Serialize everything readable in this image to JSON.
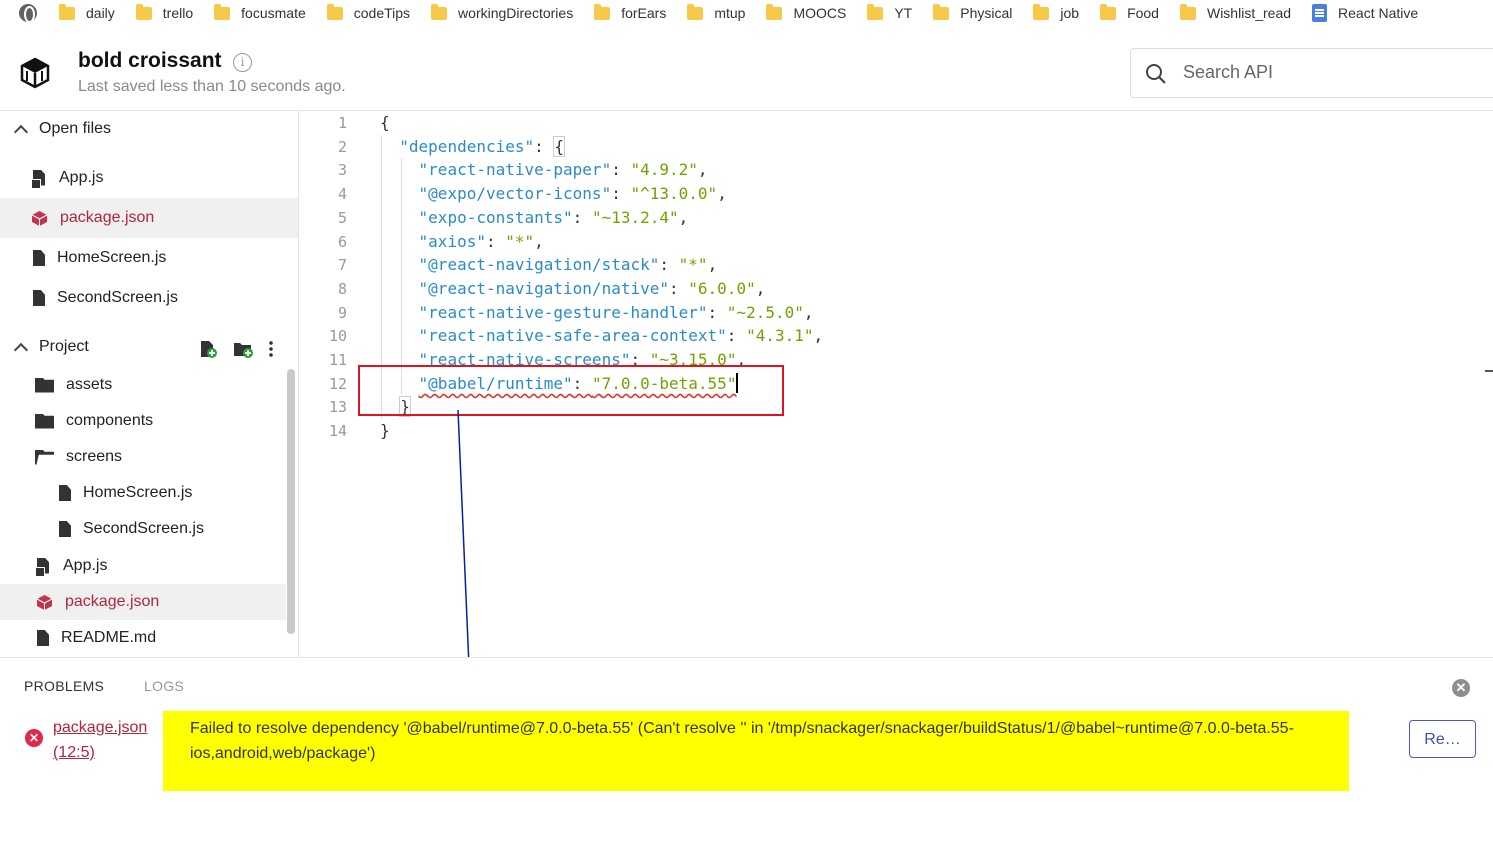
{
  "bookmarks": [
    {
      "label": "daily",
      "icon": "folder-icon"
    },
    {
      "label": "trello",
      "icon": "folder-icon"
    },
    {
      "label": "focusmate",
      "icon": "folder-icon"
    },
    {
      "label": "codeTips",
      "icon": "folder-icon"
    },
    {
      "label": "workingDirectories",
      "icon": "folder-icon"
    },
    {
      "label": "forEars",
      "icon": "folder-icon"
    },
    {
      "label": "mtup",
      "icon": "folder-icon"
    },
    {
      "label": "MOOCS",
      "icon": "folder-icon"
    },
    {
      "label": "YT",
      "icon": "folder-icon"
    },
    {
      "label": "Physical",
      "icon": "folder-icon"
    },
    {
      "label": "job",
      "icon": "folder-icon"
    },
    {
      "label": "Food",
      "icon": "folder-icon"
    },
    {
      "label": "Wishlist_read",
      "icon": "folder-icon"
    },
    {
      "label": "React Native",
      "icon": "doc-icon"
    }
  ],
  "header": {
    "title": "bold croissant",
    "saved": "Last saved less than 10 seconds ago.",
    "info_glyph": "i",
    "search_placeholder": "Search API"
  },
  "sidebar": {
    "open_files_label": "Open files",
    "open_files": [
      "App.js",
      "package.json",
      "HomeScreen.js",
      "SecondScreen.js"
    ],
    "project_label": "Project",
    "project_items": [
      "assets",
      "components",
      "screens",
      "HomeScreen.js",
      "SecondScreen.js",
      "App.js",
      "package.json",
      "README.md"
    ]
  },
  "editor": {
    "line_numbers": [
      "1",
      "2",
      "3",
      "4",
      "5",
      "6",
      "7",
      "8",
      "9",
      "10",
      "11",
      "12",
      "13",
      "14"
    ],
    "deps": [
      {
        "name": "react-native-paper",
        "version": "4.9.2"
      },
      {
        "name": "@expo/vector-icons",
        "version": "^13.0.0"
      },
      {
        "name": "expo-constants",
        "version": "~13.2.4"
      },
      {
        "name": "axios",
        "version": "*"
      },
      {
        "name": "@react-navigation/stack",
        "version": "*"
      },
      {
        "name": "@react-navigation/native",
        "version": "6.0.0"
      },
      {
        "name": "react-native-gesture-handler",
        "version": "~2.5.0"
      },
      {
        "name": "react-native-safe-area-context",
        "version": "4.3.1"
      },
      {
        "name": "react-native-screens",
        "version": "~3.15.0"
      },
      {
        "name": "@babel/runtime",
        "version": "7.0.0-beta.55"
      }
    ],
    "root_key": "dependencies",
    "brace_open": "{",
    "brace_close": "}"
  },
  "panel": {
    "tab_problems": "PROBLEMS",
    "tab_logs": "LOGS",
    "close_glyph": "✕",
    "error_glyph": "✕",
    "error_file": "package.json",
    "error_pos": "(12:5)",
    "error_message": "Failed to resolve dependency '@babel/runtime@7.0.0-beta.55' (Can't resolve '' in '/tmp/snackager/snackager/buildStatus/1/@babel~runtime@7.0.0-beta.55-ios,android,web/package')",
    "retry_label": "Re…"
  },
  "colors": {
    "key": "#2a8bc7",
    "value": "#6da400",
    "error": "#b0263a",
    "highlight": "#ffff00",
    "annotation": "#e0141e",
    "arrow": "#0a1f9e"
  }
}
